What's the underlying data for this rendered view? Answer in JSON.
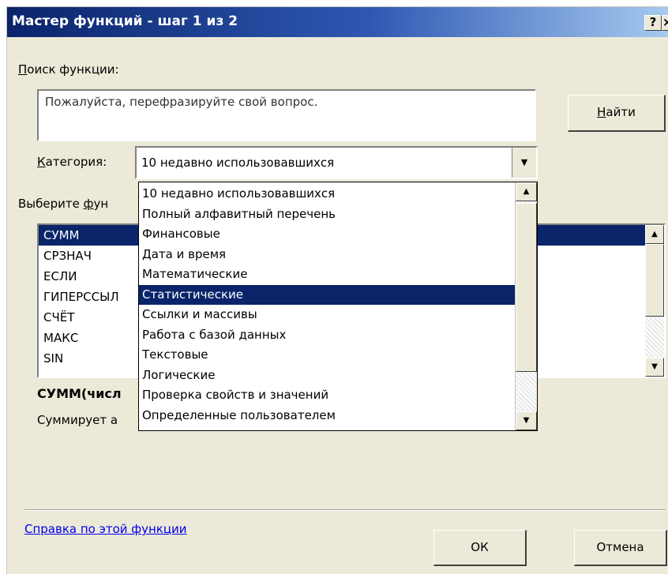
{
  "window": {
    "title": "Мастер функций - шаг 1 из 2",
    "help_button": "?",
    "close_button": "×"
  },
  "search": {
    "label_underlined": "П",
    "label_rest": "оиск функции:",
    "value": "Пожалуйста, перефразируйте свой вопрос.",
    "find_button_underlined": "Н",
    "find_button_rest": "айти"
  },
  "category": {
    "label_underlined": "К",
    "label_rest": "атегория:",
    "selected": "10 недавно использовавшихся",
    "arrow_icon": "chevron-down-icon"
  },
  "function_list": {
    "label_prefix": "Выберите ",
    "label_underlined": "ф",
    "label_rest": "ун",
    "items": [
      "СУММ",
      "СРЗНАЧ",
      "ЕСЛИ",
      "ГИПЕРССЫЛ",
      "СЧЁТ",
      "МАКС",
      "SIN"
    ],
    "selected_index": 0
  },
  "function_info": {
    "signature": "СУММ(числ",
    "description": "Суммирует а"
  },
  "dropdown": {
    "items": [
      "10 недавно использовавшихся",
      "Полный алфавитный перечень",
      "Финансовые",
      "Дата и время",
      "Математические",
      "Статистические",
      "Ссылки и массивы",
      "Работа с базой данных",
      "Текстовые",
      "Логические",
      "Проверка свойств и значений",
      "Определенные пользователем"
    ],
    "highlighted_index": 5
  },
  "footer": {
    "help_link": "Справка по этой функции",
    "ok_button": "ОК",
    "cancel_button": "Отмена"
  }
}
